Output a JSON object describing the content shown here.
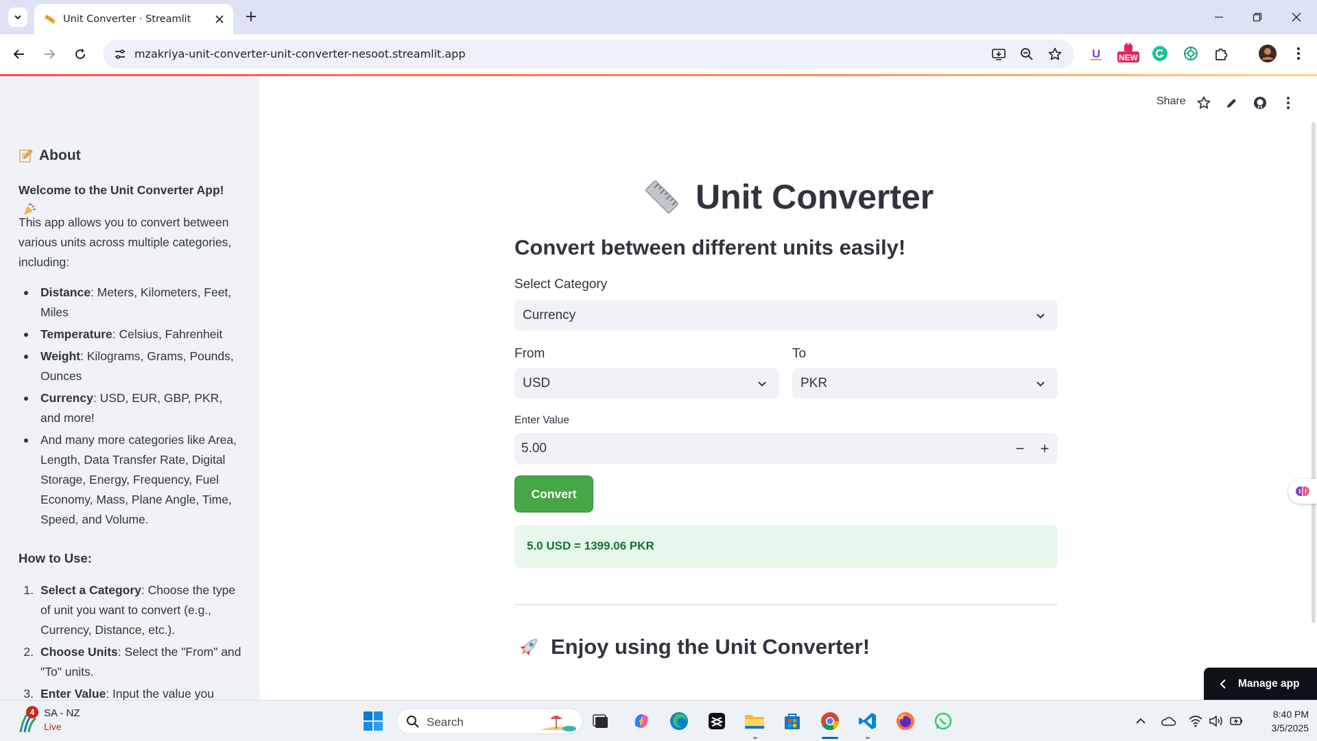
{
  "browser": {
    "tab_title": "Unit Converter · Streamlit",
    "url": "mzakriya-unit-converter-unit-converter-nesoot.streamlit.app",
    "ext_new_badge": "NEW"
  },
  "header": {
    "share_label": "Share"
  },
  "sidebar": {
    "about_heading": "About",
    "welcome": "Welcome to the Unit Converter App!",
    "intro": "This app allows you to convert between various units across multiple categories, including:",
    "categories": [
      {
        "bold": "Distance",
        "text": ": Meters, Kilometers, Feet, Miles"
      },
      {
        "bold": "Temperature",
        "text": ": Celsius, Fahrenheit"
      },
      {
        "bold": "Weight",
        "text": ": Kilograms, Grams, Pounds, Ounces"
      },
      {
        "bold": "Currency",
        "text": ": USD, EUR, GBP, PKR, and more!"
      },
      {
        "bold": "",
        "text": "And many more categories like Area, Length, Data Transfer Rate, Digital Storage, Energy, Frequency, Fuel Economy, Mass, Plane Angle, Time, Speed, and Volume."
      }
    ],
    "howto_heading": "How to Use:",
    "steps": [
      {
        "num": "1.",
        "bold": "Select a Category",
        "text": ": Choose the type of unit you want to convert (e.g., Currency, Distance, etc.)."
      },
      {
        "num": "2.",
        "bold": "Choose Units",
        "text": ": Select the \"From\" and \"To\" units."
      },
      {
        "num": "3.",
        "bold": "Enter Value",
        "text": ": Input the value you want"
      }
    ]
  },
  "main": {
    "title": "Unit Converter",
    "subheader": "Convert between different units easily!",
    "category_label": "Select Category",
    "category_value": "Currency",
    "from_label": "From",
    "from_value": "USD",
    "to_label": "To",
    "to_value": "PKR",
    "value_label": "Enter Value",
    "value": "5.00",
    "minus": "−",
    "plus": "+",
    "convert_label": "Convert",
    "result": "5.0 USD = 1399.06 PKR",
    "enjoy": "Enjoy using the Unit Converter!",
    "manage_app": "Manage app"
  },
  "taskbar": {
    "weather_title": "SA - NZ",
    "weather_sub": "Live",
    "weather_badge": "4",
    "search_placeholder": "Search",
    "time": "8:40 PM",
    "date": "3/5/2025"
  },
  "colors": {
    "accent_green": "#45a745",
    "result_bg": "#e7f7ec",
    "result_text": "#177233",
    "sidebar_bg": "#f0f2f6"
  }
}
